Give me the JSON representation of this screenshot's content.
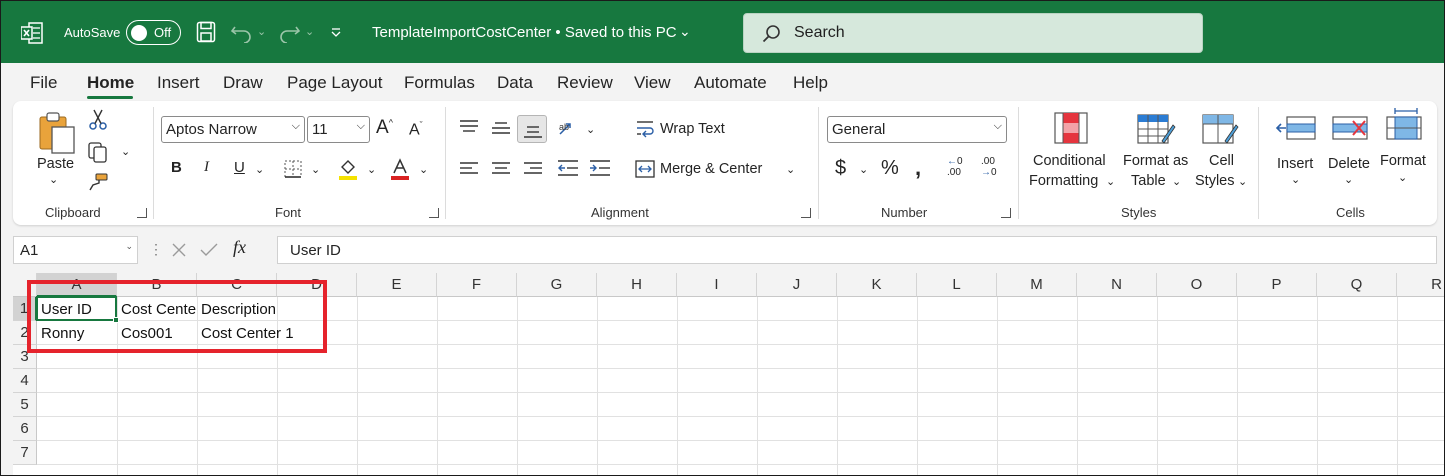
{
  "titlebar": {
    "autosave_label": "AutoSave",
    "autosave_state": "Off",
    "document_title": "TemplateImportCostCenter • Saved to this PC",
    "search_placeholder": "Search",
    "bg_color": "#17783f"
  },
  "menu": {
    "tabs": [
      "File",
      "Home",
      "Insert",
      "Draw",
      "Page Layout",
      "Formulas",
      "Data",
      "Review",
      "View",
      "Automate",
      "Help"
    ],
    "active": "Home"
  },
  "ribbon": {
    "clipboard": {
      "paste": "Paste",
      "group": "Clipboard"
    },
    "font": {
      "family": "Aptos Narrow",
      "size": "11",
      "group": "Font"
    },
    "alignment": {
      "wrap_text": "Wrap Text",
      "merge_center": "Merge & Center",
      "group": "Alignment"
    },
    "number": {
      "format": "General",
      "group": "Number"
    },
    "styles": {
      "conditional_1": "Conditional",
      "conditional_2": "Formatting",
      "format_table_1": "Format as",
      "format_table_2": "Table",
      "cell_styles_1": "Cell",
      "cell_styles_2": "Styles",
      "group": "Styles"
    },
    "cells": {
      "insert": "Insert",
      "delete": "Delete",
      "format": "Format",
      "group": "Cells"
    }
  },
  "formula_bar": {
    "name_box": "A1",
    "fx": "fx",
    "content": "User ID"
  },
  "sheet": {
    "columns": [
      "A",
      "B",
      "C",
      "D",
      "E",
      "F",
      "G",
      "H",
      "I",
      "J",
      "K",
      "L",
      "M",
      "N",
      "O",
      "P",
      "Q",
      "R"
    ],
    "rows": [
      "1",
      "2",
      "3",
      "4",
      "5",
      "6",
      "7"
    ],
    "cells": {
      "A1": "User ID",
      "B1": "Cost Cente",
      "C1": "Description",
      "A2": "Ronny",
      "B2": "Cos001",
      "C2": "Cost Center 1"
    },
    "accent_color": "#17783f",
    "highlight_color": "#e5232c"
  }
}
